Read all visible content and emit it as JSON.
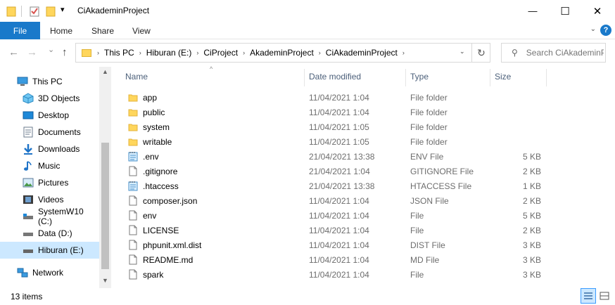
{
  "window": {
    "title": "CiAkademinProject",
    "minimize_glyph": "—",
    "maximize_glyph": "☐",
    "close_glyph": "✕"
  },
  "quick_access": {
    "dropdown_glyph": "▾"
  },
  "ribbon": {
    "file_tab": "File",
    "tabs": [
      "Home",
      "Share",
      "View"
    ],
    "expand_glyph": "⌄",
    "help_glyph": "?"
  },
  "nav_buttons": {
    "back": "←",
    "forward": "→",
    "recent": "⌄",
    "up": "↑"
  },
  "address": {
    "crumbs": [
      "This PC",
      "Hiburan (E:)",
      "CiProject",
      "AkademinProject",
      "CiAkademinProject"
    ],
    "separator": "›",
    "dropdown_glyph": "⌄",
    "refresh_glyph": "↻"
  },
  "search": {
    "icon_glyph": "⚲",
    "placeholder": "Search CiAkademinP..."
  },
  "nav_pane": {
    "items": [
      {
        "label": "This PC",
        "icon": "this-pc-icon"
      },
      {
        "label": "3D Objects",
        "icon": "3d-objects-icon"
      },
      {
        "label": "Desktop",
        "icon": "desktop-icon"
      },
      {
        "label": "Documents",
        "icon": "documents-icon"
      },
      {
        "label": "Downloads",
        "icon": "downloads-icon"
      },
      {
        "label": "Music",
        "icon": "music-icon"
      },
      {
        "label": "Pictures",
        "icon": "pictures-icon"
      },
      {
        "label": "Videos",
        "icon": "videos-icon"
      },
      {
        "label": "SystemW10 (C:)",
        "icon": "drive-c-icon"
      },
      {
        "label": "Data (D:)",
        "icon": "drive-d-icon"
      },
      {
        "label": "Hiburan (E:)",
        "icon": "drive-e-icon"
      },
      {
        "label": "Network",
        "icon": "network-icon"
      }
    ],
    "selected": "Hiburan (E:)",
    "scroll_up": "▲",
    "scroll_down": "▼"
  },
  "columns": {
    "name": "Name",
    "date": "Date modified",
    "type": "Type",
    "size": "Size",
    "sort_glyph": "^"
  },
  "files": [
    {
      "name": "app",
      "date": "11/04/2021 1:04",
      "type": "File folder",
      "size": "",
      "kind": "folder"
    },
    {
      "name": "public",
      "date": "11/04/2021 1:04",
      "type": "File folder",
      "size": "",
      "kind": "folder"
    },
    {
      "name": "system",
      "date": "11/04/2021 1:05",
      "type": "File folder",
      "size": "",
      "kind": "folder"
    },
    {
      "name": "writable",
      "date": "11/04/2021 1:05",
      "type": "File folder",
      "size": "",
      "kind": "folder"
    },
    {
      "name": ".env",
      "date": "21/04/2021 13:38",
      "type": "ENV File",
      "size": "5 KB",
      "kind": "notepad"
    },
    {
      "name": ".gitignore",
      "date": "21/04/2021 1:04",
      "type": "GITIGNORE File",
      "size": "2 KB",
      "kind": "file"
    },
    {
      "name": ".htaccess",
      "date": "21/04/2021 13:38",
      "type": "HTACCESS File",
      "size": "1 KB",
      "kind": "notepad"
    },
    {
      "name": "composer.json",
      "date": "11/04/2021 1:04",
      "type": "JSON File",
      "size": "2 KB",
      "kind": "file"
    },
    {
      "name": "env",
      "date": "11/04/2021 1:04",
      "type": "File",
      "size": "5 KB",
      "kind": "file"
    },
    {
      "name": "LICENSE",
      "date": "11/04/2021 1:04",
      "type": "File",
      "size": "2 KB",
      "kind": "file"
    },
    {
      "name": "phpunit.xml.dist",
      "date": "11/04/2021 1:04",
      "type": "DIST File",
      "size": "3 KB",
      "kind": "file"
    },
    {
      "name": "README.md",
      "date": "11/04/2021 1:04",
      "type": "MD File",
      "size": "3 KB",
      "kind": "file"
    },
    {
      "name": "spark",
      "date": "11/04/2021 1:04",
      "type": "File",
      "size": "3 KB",
      "kind": "file"
    }
  ],
  "status": {
    "item_count": "13 items"
  },
  "colors": {
    "accent": "#1979ca",
    "selection": "#cce8ff",
    "folder": "#ffd65c",
    "header_text": "#4c607a",
    "secondary_text": "#6d6d6d"
  }
}
